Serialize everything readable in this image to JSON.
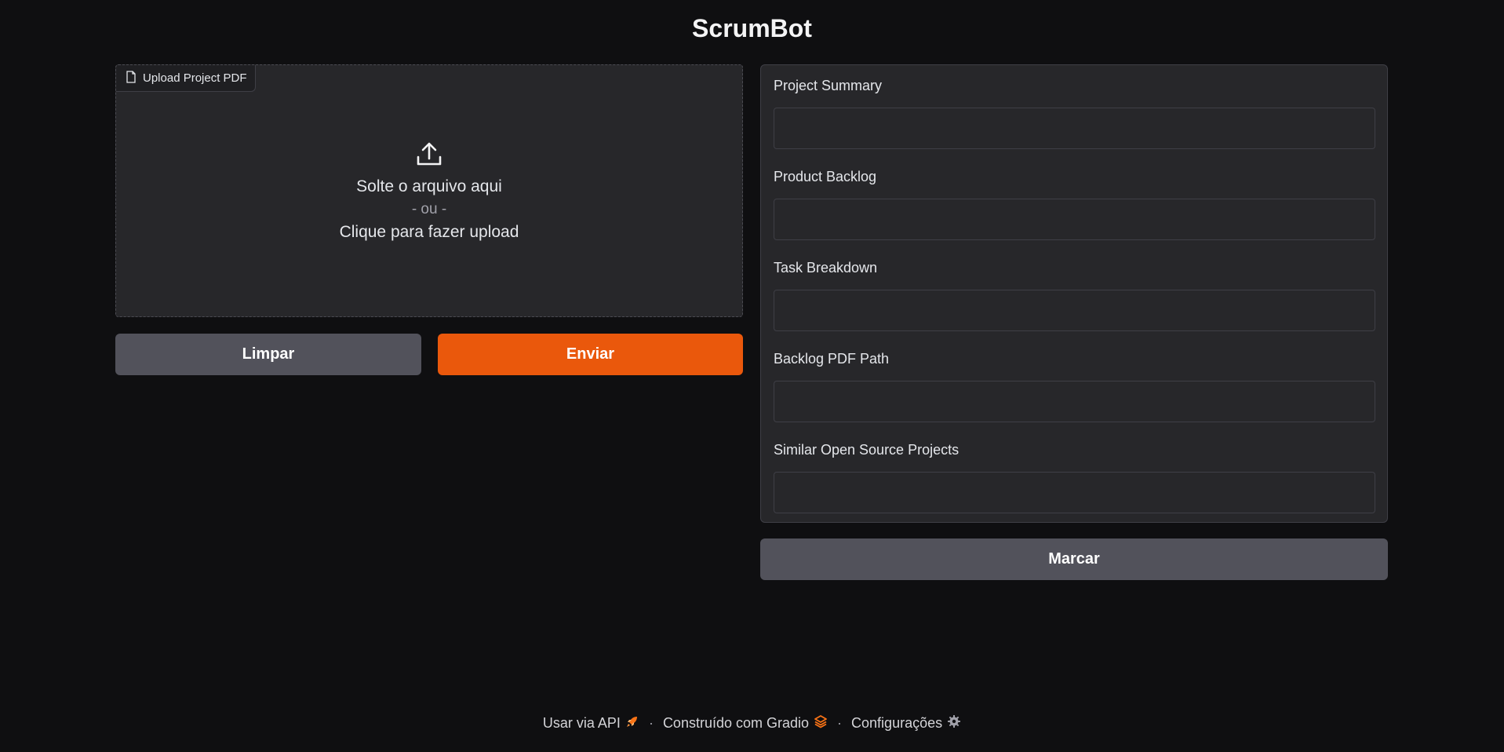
{
  "app": {
    "title": "ScrumBot"
  },
  "upload": {
    "label": "Upload Project PDF",
    "drop_text": "Solte o arquivo aqui",
    "or_text": "- ou -",
    "click_text": "Clique para fazer upload"
  },
  "buttons": {
    "clear": "Limpar",
    "submit": "Enviar",
    "flag": "Marcar"
  },
  "outputs": [
    {
      "label": "Project Summary",
      "value": ""
    },
    {
      "label": "Product Backlog",
      "value": ""
    },
    {
      "label": "Task Breakdown",
      "value": ""
    },
    {
      "label": "Backlog PDF Path",
      "value": ""
    },
    {
      "label": "Similar Open Source Projects",
      "value": ""
    }
  ],
  "footer": {
    "api": "Usar via API",
    "built_with": "Construído com Gradio",
    "settings": "Configurações",
    "separator": "·"
  },
  "colors": {
    "background": "#0f0f11",
    "panel": "#27272a",
    "primary": "#ea580c",
    "secondary": "#52525b"
  },
  "icons": {
    "upload_tag": "file-icon",
    "upload": "upload-icon",
    "api": "rocket-icon",
    "gradio": "gradio-logo-icon",
    "settings": "gear-icon"
  }
}
